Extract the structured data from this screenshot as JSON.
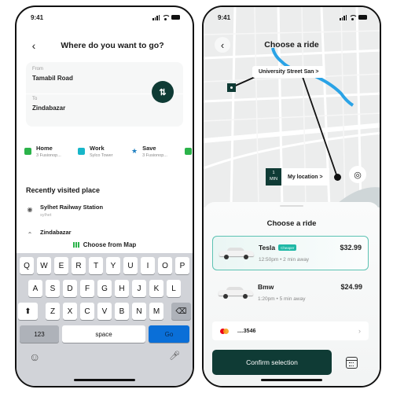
{
  "left_screen": {
    "status": {
      "time": "9:41"
    },
    "header": {
      "back_icon": "chevron-left-icon",
      "title": "Where do you want to go?"
    },
    "route": {
      "from_label": "From",
      "from_value": "Tamabil Road",
      "to_label": "To",
      "to_value": "Zindabazar",
      "swap_icon": "swap-vertical-icon",
      "swap_glyph": "⇅"
    },
    "saved_places": [
      {
        "name": "Home",
        "sub": "3 Fusionop...",
        "icon": "home-icon",
        "color": "#2bb34a"
      },
      {
        "name": "Work",
        "sub": "Sylco Tower",
        "icon": "briefcase-icon",
        "color": "#17b6c9"
      },
      {
        "name": "Save",
        "sub": "3 Fusionop...",
        "icon": "star-icon",
        "color": "#1e7fc1"
      }
    ],
    "recent": {
      "title": "Recently visited place",
      "items": [
        {
          "name": "Sylhet Railway Station",
          "sub": "sylhet"
        },
        {
          "name": "Zindabazar",
          "sub": ""
        }
      ]
    },
    "choose_map": {
      "label": "Choose from Map",
      "icon": "map-icon"
    },
    "keyboard": {
      "row1": [
        "Q",
        "W",
        "E",
        "R",
        "T",
        "Y",
        "U",
        "I",
        "O",
        "P"
      ],
      "row2": [
        "A",
        "S",
        "D",
        "F",
        "G",
        "H",
        "J",
        "K",
        "L"
      ],
      "row3": [
        "Z",
        "X",
        "C",
        "V",
        "B",
        "N",
        "M"
      ],
      "shift": "⬆",
      "backspace": "⌫",
      "numbers": "123",
      "space": "space",
      "go": "Go",
      "emoji": "☺",
      "mic": "🎙"
    }
  },
  "right_screen": {
    "status": {
      "time": "9:41"
    },
    "header": {
      "back_icon": "chevron-left-icon",
      "title": "Choose a ride"
    },
    "map": {
      "destination_label": "University Street San  >",
      "eta_value": "1",
      "eta_unit": "MIN",
      "my_location_label": "My location  >",
      "locate_icon": "crosshair-icon"
    },
    "sheet": {
      "title": "Choose a ride",
      "rides": [
        {
          "name": "Tesla",
          "badge": "Cheaper",
          "time": "12:50pm",
          "away": "2 min away",
          "meta": "12:50pm  •  2 min away",
          "price": "$32.99",
          "selected": true
        },
        {
          "name": "Bmw",
          "badge": "",
          "time": "1:20pm",
          "away": "5 min away",
          "meta": "1:20pm  •  5 min away",
          "price": "$24.99",
          "selected": false
        }
      ],
      "payment": {
        "card_brand": "mastercard",
        "card_number": "....3546"
      },
      "confirm_label": "Confirm selection",
      "schedule_icon": "calendar-icon"
    },
    "colors": {
      "primary": "#0f3b35",
      "accent": "#1fb8a6",
      "route_water": "#2aa3e6"
    }
  }
}
